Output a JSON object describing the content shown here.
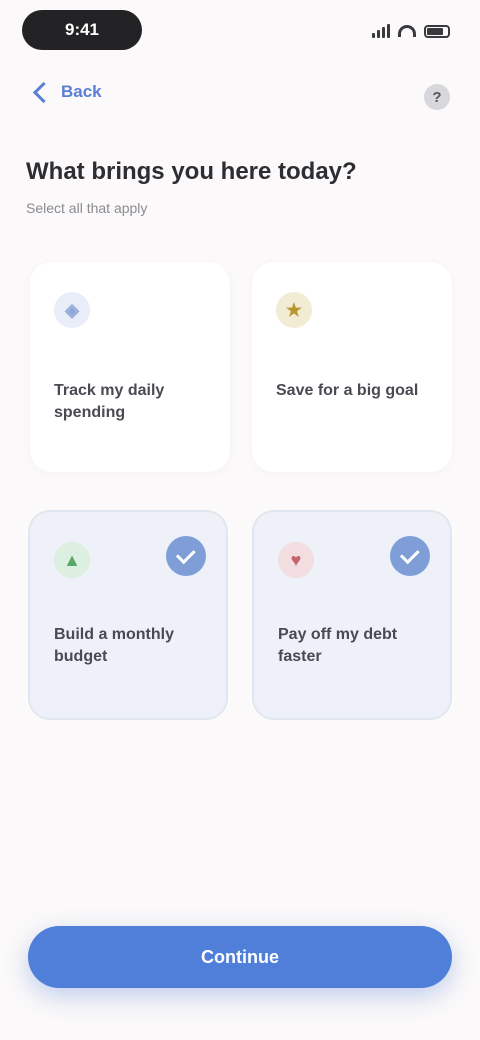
{
  "status_bar": {
    "time": "9:41",
    "icons": [
      "signal-icon",
      "wifi-icon",
      "battery-icon"
    ]
  },
  "nav": {
    "back_label": "Back",
    "help_icon": "question-icon",
    "help_glyph": "?"
  },
  "header": {
    "title": "What brings you here today?",
    "subtitle": "Select all that apply"
  },
  "options": [
    {
      "title": "Track my daily spending",
      "icon": "wallet-icon",
      "icon_glyph": "◈",
      "selected": false
    },
    {
      "title": "Save for a big goal",
      "icon": "star-icon",
      "icon_glyph": "★",
      "selected": false
    },
    {
      "title": "Build a monthly budget",
      "icon": "chart-icon",
      "icon_glyph": "▲",
      "selected": true
    },
    {
      "title": "Pay off my debt faster",
      "icon": "heart-icon",
      "icon_glyph": "♥",
      "selected": true
    }
  ],
  "continue_label": "Continue",
  "colors": {
    "accent": "#4f7fd9",
    "selected_card_bg": "#eef2f8",
    "background": "#fbf9f9"
  }
}
